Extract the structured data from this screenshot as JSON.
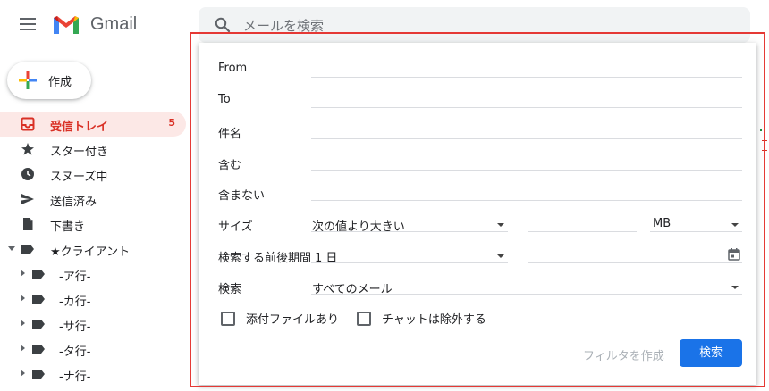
{
  "app": {
    "name": "Gmail"
  },
  "search": {
    "placeholder": "メールを検索"
  },
  "sidebar": {
    "compose_label": "作成",
    "items": [
      {
        "label": "受信トレイ",
        "count": "5",
        "icon": "inbox-icon",
        "active": true
      },
      {
        "label": "スター付き",
        "icon": "star-icon"
      },
      {
        "label": "スヌーズ中",
        "icon": "clock-icon"
      },
      {
        "label": "送信済み",
        "icon": "send-icon"
      },
      {
        "label": "下書き",
        "icon": "draft-icon"
      },
      {
        "label": "★クライアント",
        "icon": "label-icon"
      },
      {
        "label": "-ア行-",
        "icon": "label-icon"
      },
      {
        "label": "-カ行-",
        "icon": "label-icon"
      },
      {
        "label": "-サ行-",
        "icon": "label-icon"
      },
      {
        "label": "-タ行-",
        "icon": "label-icon"
      },
      {
        "label": "-ナ行-",
        "icon": "label-icon"
      }
    ]
  },
  "advanced_search": {
    "from_label": "From",
    "to_label": "To",
    "subject_label": "件名",
    "has_words_label": "含む",
    "doesnt_have_label": "含まない",
    "size_label": "サイズ",
    "size_operator": "次の値より大きい",
    "size_unit": "MB",
    "date_within_label": "検索する前後期間",
    "date_within_value": "1 日",
    "search_in_label": "検索",
    "search_in_value": "すべてのメール",
    "has_attachment_label": "添付ファイルあり",
    "exclude_chats_label": "チャットは除外する",
    "create_filter_label": "フィルタを作成",
    "search_button_label": "検索"
  },
  "colors": {
    "accent_red": "#d93025",
    "primary_blue": "#1a73e8",
    "highlight_border": "#e53935"
  }
}
